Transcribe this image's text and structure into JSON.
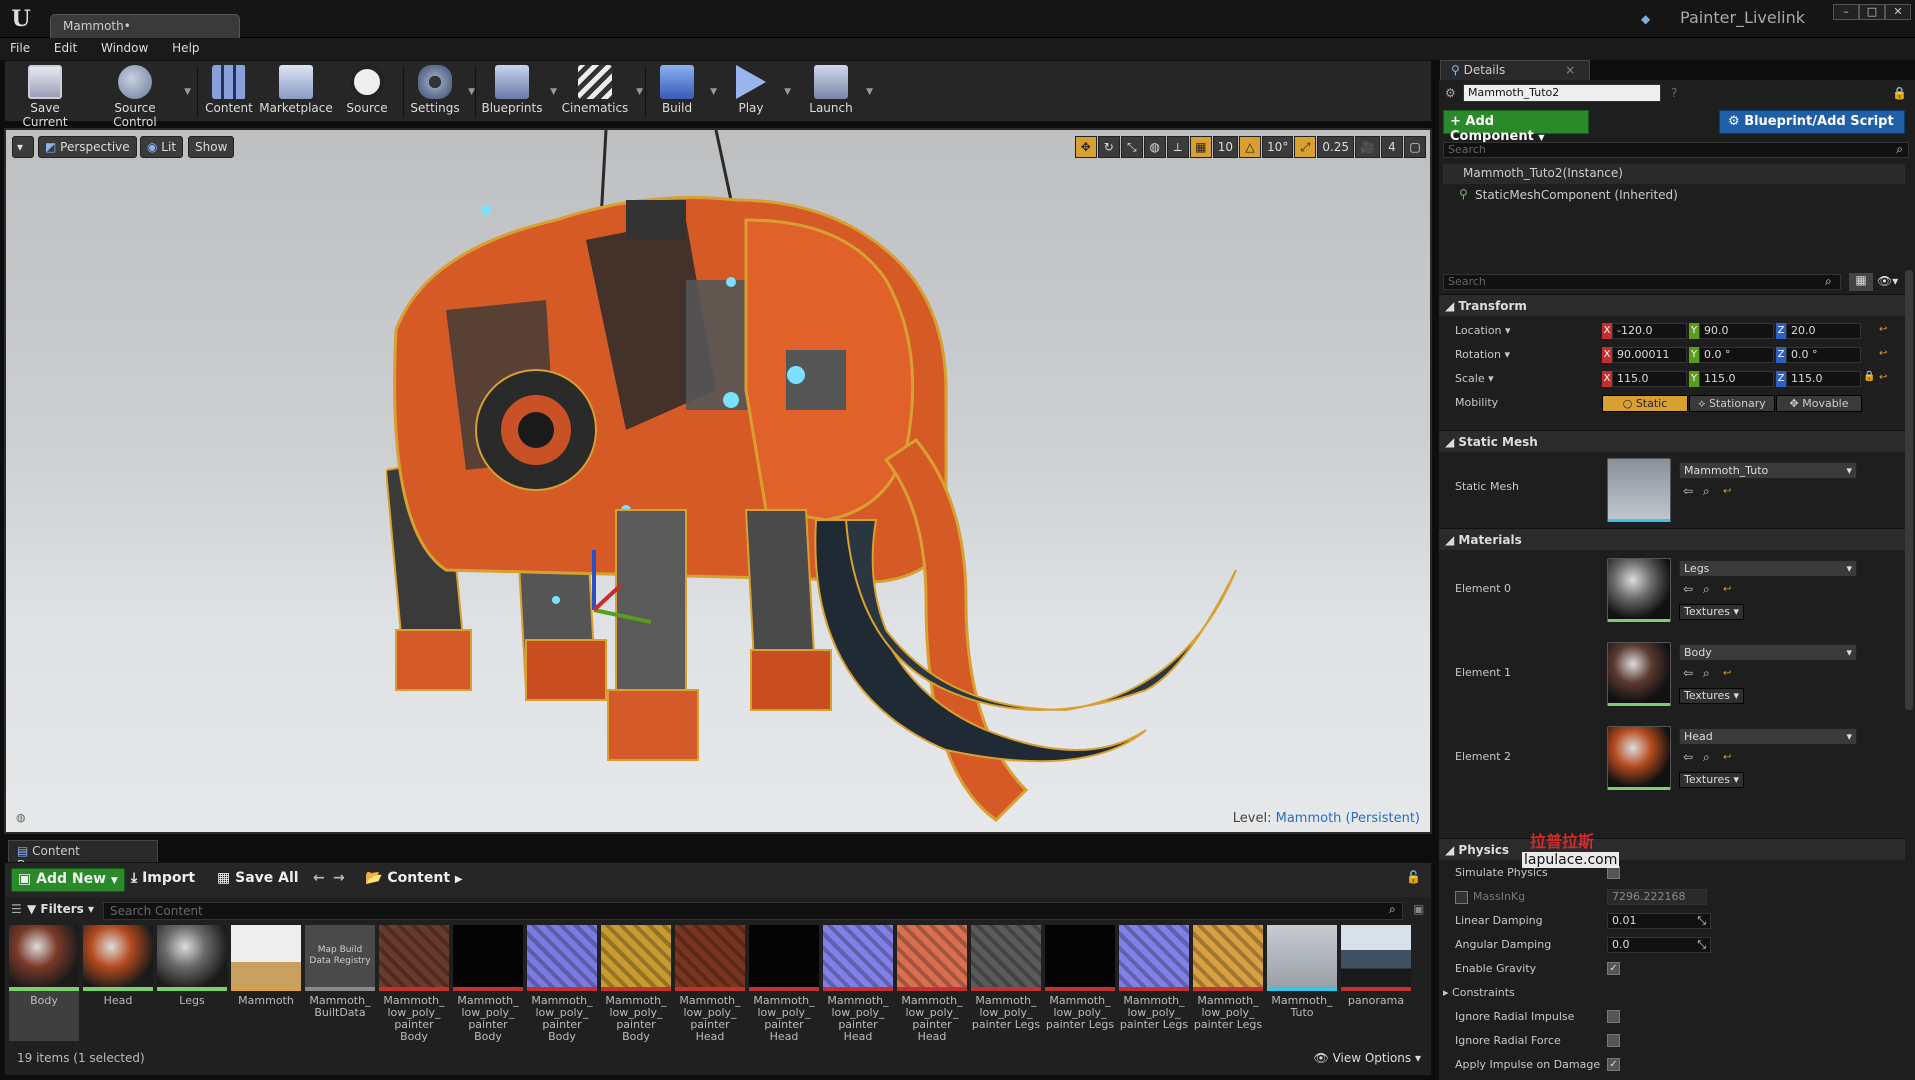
{
  "window": {
    "tab_title": "Mammoth•",
    "project_name": "Painter_Livelink"
  },
  "menu": [
    "File",
    "Edit",
    "Window",
    "Help"
  ],
  "toolbar": {
    "buttons": [
      {
        "label": "Save Current"
      },
      {
        "label": "Source Control"
      },
      {
        "label": "Content"
      },
      {
        "label": "Marketplace"
      },
      {
        "label": "Source"
      },
      {
        "label": "Settings"
      },
      {
        "label": "Blueprints"
      },
      {
        "label": "Cinematics"
      },
      {
        "label": "Build"
      },
      {
        "label": "Play"
      },
      {
        "label": "Launch"
      }
    ]
  },
  "viewport": {
    "perspective": "Perspective",
    "lit": "Lit",
    "show": "Show",
    "grid_snap": "10",
    "rot_snap": "10°",
    "scale_snap": "0.25",
    "cam_speed": "4",
    "level_prefix": "Level:",
    "level_name": "Mammoth (Persistent)"
  },
  "content_browser": {
    "tab": "Content Browser",
    "add_new": "Add New",
    "import": "Import",
    "save_all": "Save All",
    "path": "Content",
    "filters": "Filters",
    "search_placeholder": "Search Content",
    "items_count": "19 items (1 selected)",
    "view_options": "View Options",
    "assets": [
      {
        "label": "Body",
        "kind": "sphere",
        "color": "#7a3a2a",
        "bar": "#7ad06a",
        "selected": true
      },
      {
        "label": "Head",
        "kind": "sphere",
        "color": "#b44a1e",
        "bar": "#7ad06a"
      },
      {
        "label": "Legs",
        "kind": "sphere",
        "color": "#6a6a6a",
        "bar": "#7ad06a"
      },
      {
        "label": "Mammoth",
        "kind": "mesh",
        "color": "#c8a060",
        "bar": "#d8a040"
      },
      {
        "label": "Mammoth_ BuiltData",
        "kind": "text",
        "color": "#4a4a4a",
        "bar": "#888888",
        "thumb_text": "Map Build Data Registry"
      },
      {
        "label": "Mammoth_ low_poly_ painter Body",
        "kind": "tex",
        "color": "#6a3a2a",
        "bar": "#c43030"
      },
      {
        "label": "Mammoth_ low_poly_ painter Body",
        "kind": "tex",
        "color": "#050505",
        "bar": "#c43030"
      },
      {
        "label": "Mammoth_ low_poly_ painter Body",
        "kind": "tex",
        "color": "#7a7ae0",
        "bar": "#c43030"
      },
      {
        "label": "Mammoth_ low_poly_ painter Body",
        "kind": "tex",
        "color": "#c89a30",
        "bar": "#c43030"
      },
      {
        "label": "Mammoth_ low_poly_ painter Head",
        "kind": "tex",
        "color": "#7a3520",
        "bar": "#c43030"
      },
      {
        "label": "Mammoth_ low_poly_ painter Head",
        "kind": "tex",
        "color": "#050505",
        "bar": "#c43030"
      },
      {
        "label": "Mammoth_ low_poly_ painter Head",
        "kind": "tex",
        "color": "#8080e8",
        "bar": "#c43030"
      },
      {
        "label": "Mammoth_ low_poly_ painter Head",
        "kind": "tex",
        "color": "#d87050",
        "bar": "#c43030"
      },
      {
        "label": "Mammoth_ low_poly_ painter Legs",
        "kind": "tex",
        "color": "#5a5a5a",
        "bar": "#c43030"
      },
      {
        "label": "Mammoth_ low_poly_ painter Legs",
        "kind": "tex",
        "color": "#050505",
        "bar": "#c43030"
      },
      {
        "label": "Mammoth_ low_poly_ painter Legs",
        "kind": "tex",
        "color": "#8080e8",
        "bar": "#c43030"
      },
      {
        "label": "Mammoth_ low_poly_ painter Legs",
        "kind": "tex",
        "color": "#d8a040",
        "bar": "#c43030"
      },
      {
        "label": "Mammoth_ Tuto",
        "kind": "mesh2",
        "color": "#aab0b8",
        "bar": "#30c8e8"
      },
      {
        "label": "panorama",
        "kind": "pano",
        "color": "#405060",
        "bar": "#c43030"
      }
    ]
  },
  "details": {
    "tab": "Details",
    "actor_name": "Mammoth_Tuto2",
    "add_component": "+ Add Component",
    "blueprint": "Blueprint/Add Script",
    "search_placeholder": "Search",
    "instance": "Mammoth_Tuto2(Instance)",
    "component": "StaticMeshComponent (Inherited)",
    "search2_placeholder": "Search",
    "transform": {
      "title": "Transform",
      "location_label": "Location",
      "rotation_label": "Rotation",
      "scale_label": "Scale",
      "mobility_label": "Mobility",
      "location": [
        "-120.0",
        "90.0",
        "20.0"
      ],
      "rotation": [
        "90.00011",
        "0.0 °",
        "0.0 °"
      ],
      "scale": [
        "115.0",
        "115.0",
        "115.0"
      ],
      "mobility": [
        "Static",
        "Stationary",
        "Movable"
      ],
      "axis_letters": [
        "X",
        "Y",
        "Z"
      ]
    },
    "static_mesh": {
      "title": "Static Mesh",
      "label": "Static Mesh",
      "value": "Mammoth_Tuto"
    },
    "materials": {
      "title": "Materials",
      "elements": [
        {
          "label": "Element 0",
          "value": "Legs",
          "tex": "Textures",
          "color": "#6a6a6a"
        },
        {
          "label": "Element 1",
          "value": "Body",
          "tex": "Textures",
          "color": "#5a3a30"
        },
        {
          "label": "Element 2",
          "value": "Head",
          "tex": "Textures",
          "color": "#b44a1e"
        }
      ]
    },
    "physics": {
      "title": "Physics",
      "simulate": "Simulate Physics",
      "mass_label": "MassInKg",
      "mass_value": "7296.222168",
      "linear_label": "Linear Damping",
      "linear_value": "0.01",
      "angular_label": "Angular Damping",
      "angular_value": "0.0",
      "gravity_label": "Enable Gravity",
      "constraints_label": "Constraints",
      "radial_impulse_label": "Ignore Radial Impulse",
      "radial_force_label": "Ignore Radial Force",
      "apply_impulse_label": "Apply Impulse on Damage"
    }
  },
  "watermark": {
    "cn": "拉普拉斯",
    "url": "lapulace.com"
  },
  "colors": {
    "accent_orange": "#d8a030",
    "add_green": "#2a8a2a",
    "blueprint_blue": "#1e5fa8"
  }
}
